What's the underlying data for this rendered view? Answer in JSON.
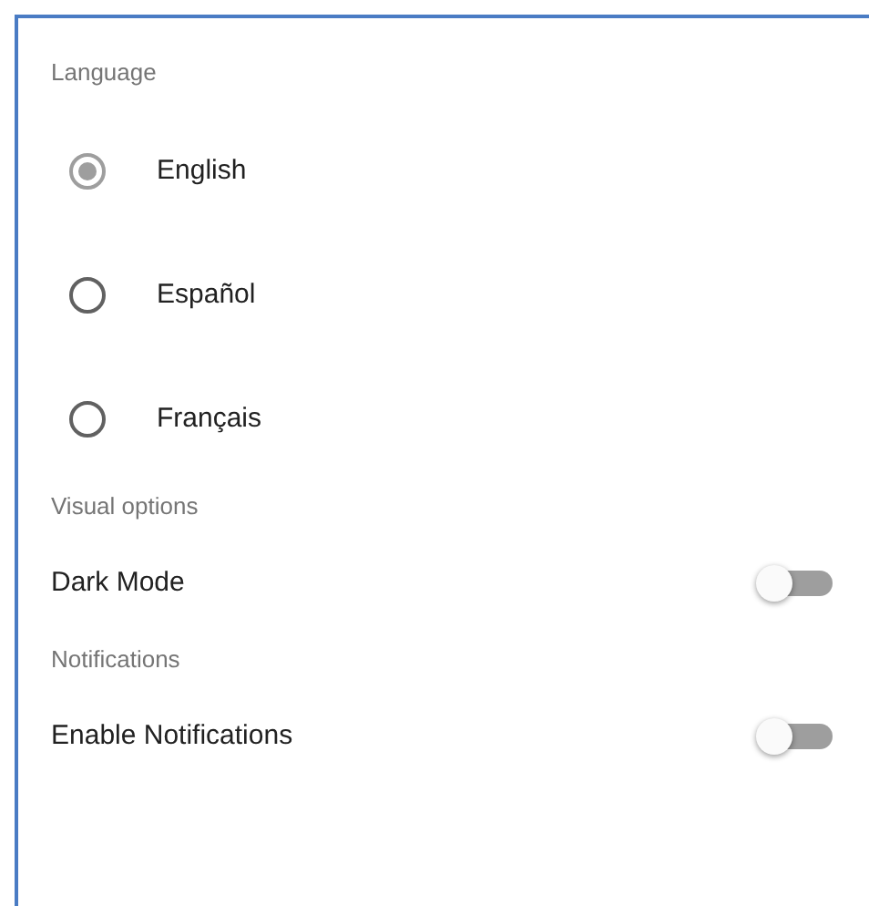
{
  "sections": [
    {
      "heading": "Language",
      "kind": "radio",
      "options": [
        {
          "label": "English",
          "selected": true
        },
        {
          "label": "Español",
          "selected": false
        },
        {
          "label": "Français",
          "selected": false
        }
      ]
    },
    {
      "heading": "Visual options",
      "kind": "switch",
      "options": [
        {
          "label": "Dark Mode",
          "on": false
        }
      ]
    },
    {
      "heading": "Notifications",
      "kind": "switch",
      "options": [
        {
          "label": "Enable Notifications",
          "on": false
        }
      ]
    }
  ]
}
